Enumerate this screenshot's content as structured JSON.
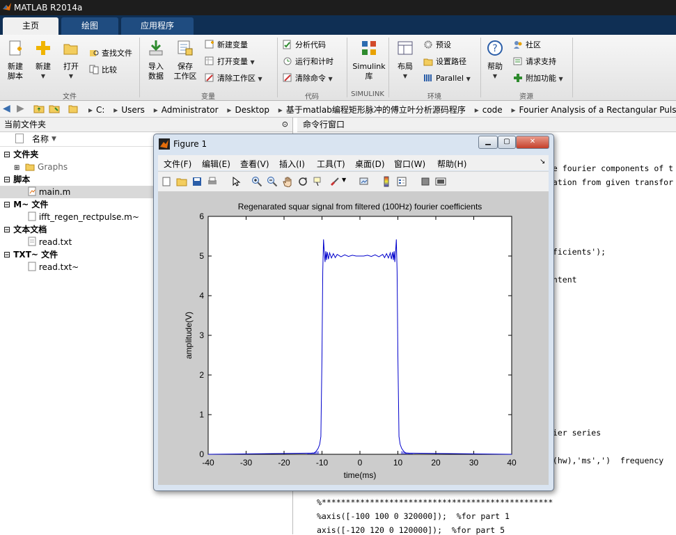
{
  "app": {
    "title": "MATLAB R2014a"
  },
  "tabs": [
    {
      "label": "主页",
      "active": true
    },
    {
      "label": "绘图"
    },
    {
      "label": "应用程序"
    }
  ],
  "ribbon": {
    "new_script": "新建\n脚本",
    "new": "新建",
    "open": "打开",
    "find_files": "查找文件",
    "compare": "比较",
    "file_section": "文件",
    "import_data": "导入\n数据",
    "save_workspace": "保存\n工作区",
    "new_variable": "新建变量",
    "open_variable": "打开变量",
    "clear_workspace": "清除工作区",
    "variable_section": "变量",
    "analyze_code": "分析代码",
    "run_and_time": "运行和计时",
    "clear_commands": "清除命令",
    "code_section": "代码",
    "simulink": "Simulink\n库",
    "simulink_section": "SIMULINK",
    "layout": "布局",
    "preferences": "预设",
    "set_path": "设置路径",
    "parallel": "Parallel",
    "environment_section": "环境",
    "help": "帮助",
    "community": "社区",
    "request_support": "请求支持",
    "addons": "附加功能",
    "resources_section": "资源"
  },
  "address": {
    "crumbs": [
      "C:",
      "Users",
      "Administrator",
      "Desktop",
      "基于matlab编程矩形脉冲的傅立叶分析源码程序",
      "code",
      "Fourier Analysis of a Rectangular Pulse"
    ]
  },
  "current_folder": {
    "title": "当前文件夹",
    "name_col": "名称",
    "groups": [
      {
        "label": "文件夹",
        "items": [
          "Graphs"
        ]
      },
      {
        "label": "脚本",
        "items": [
          "main.m"
        ]
      },
      {
        "label": "M~ 文件",
        "items": [
          "ifft_regen_rectpulse.m~"
        ]
      },
      {
        "label": "文本文档",
        "items": [
          "read.txt"
        ]
      },
      {
        "label": "TXT~ 文件",
        "items": [
          "read.txt~"
        ]
      }
    ]
  },
  "command_window": {
    "title": "命令行窗口",
    "lines": [
      "he fourier components of t",
      "mation from given transfor",
      "fficients');",
      "ontent",
      "rier series",
      "r(hw),'ms',')  frequency",
      "%************************************************",
      "%axis([-100 100 0 320000]);  %for part 1",
      "axis([-120 120 0 120000]);  %for part 5"
    ]
  },
  "figure": {
    "title": "Figure 1",
    "menu": [
      "文件(F)",
      "编辑(E)",
      "查看(V)",
      "插入(I)",
      "工具(T)",
      "桌面(D)",
      "窗口(W)",
      "帮助(H)"
    ]
  },
  "chart_data": {
    "type": "line",
    "title": "Regenarated squar signal from filtered (100Hz) fourier coefficients",
    "xlabel": "time(ms)",
    "ylabel": "amplitude(V)",
    "xlim": [
      -40,
      40
    ],
    "ylim": [
      0,
      6
    ],
    "xticks": [
      -40,
      -30,
      -20,
      -10,
      0,
      10,
      20,
      30,
      40
    ],
    "yticks": [
      0,
      1,
      2,
      3,
      4,
      5,
      6
    ],
    "series": [
      {
        "color": "#0000cc",
        "x": [
          -40,
          -12,
          -11.5,
          -11,
          -10.6,
          -10.3,
          -10,
          -9.8,
          -9.6,
          -9.4,
          -9.2,
          -9,
          -8.8,
          -8.6,
          -8.3,
          -8,
          -7.5,
          -7,
          -6.5,
          -6,
          -5,
          -4,
          -3,
          -2,
          -1,
          0,
          1,
          2,
          3,
          4,
          5,
          6,
          6.5,
          7,
          7.5,
          8,
          8.3,
          8.6,
          8.8,
          9,
          9.2,
          9.4,
          9.6,
          9.8,
          10,
          10.3,
          10.6,
          11,
          11.5,
          12,
          40
        ],
        "y": [
          0,
          0.03,
          0.08,
          0.15,
          0.25,
          0.45,
          2.5,
          4.6,
          5.42,
          5.1,
          4.85,
          5.12,
          4.9,
          5.1,
          4.92,
          5.08,
          4.95,
          5.06,
          4.96,
          5.04,
          4.98,
          5.03,
          4.99,
          5.02,
          5.0,
          5.0,
          5.0,
          5.02,
          4.99,
          5.03,
          4.98,
          5.04,
          4.96,
          5.06,
          4.95,
          5.08,
          4.92,
          5.1,
          4.9,
          5.12,
          4.85,
          5.1,
          5.42,
          4.6,
          2.5,
          0.45,
          0.25,
          0.15,
          0.08,
          0.03,
          0
        ]
      }
    ]
  }
}
